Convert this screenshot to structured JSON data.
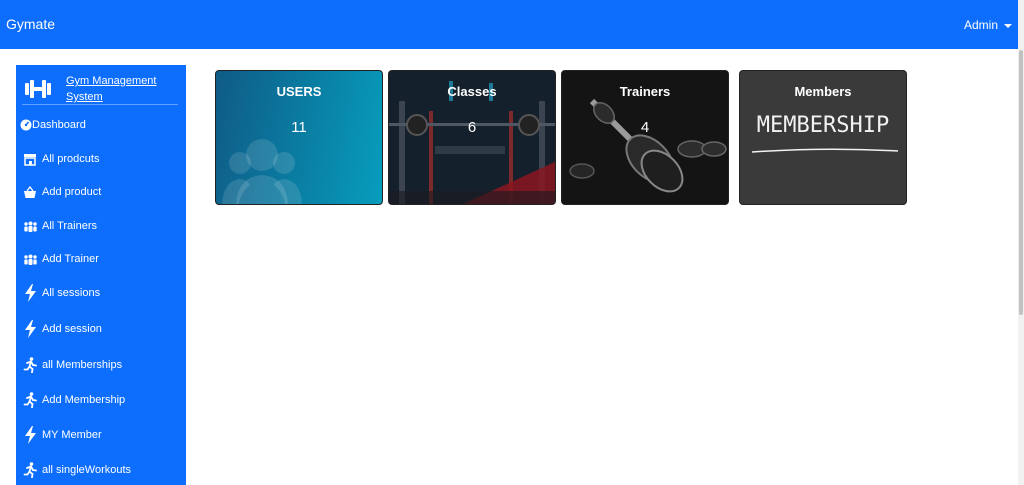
{
  "navbar": {
    "brand": "Gymate",
    "user_menu": "Admin"
  },
  "sidebar": {
    "title": "Gym Management System",
    "items": [
      {
        "label": "Dashboard",
        "icon": "gauge-icon"
      },
      {
        "label": "All prodcuts",
        "icon": "store-icon"
      },
      {
        "label": "Add product",
        "icon": "basket-icon"
      },
      {
        "label": "All Trainers",
        "icon": "people-icon"
      },
      {
        "label": "Add Trainer",
        "icon": "people-icon"
      },
      {
        "label": "All sessions",
        "icon": "bolt-icon"
      },
      {
        "label": "Add session",
        "icon": "bolt-icon"
      },
      {
        "label": "all Memberships",
        "icon": "running-icon"
      },
      {
        "label": "Add Membership",
        "icon": "running-icon"
      },
      {
        "label": "MY Member",
        "icon": "bolt-icon"
      },
      {
        "label": "all singleWorkouts",
        "icon": "running-icon"
      }
    ]
  },
  "cards": [
    {
      "title": "USERS",
      "value": "11"
    },
    {
      "title": "Classes",
      "value": "6"
    },
    {
      "title": "Trainers",
      "value": "4"
    },
    {
      "title": "Members",
      "image_text": "MEMBERSHIP"
    }
  ]
}
